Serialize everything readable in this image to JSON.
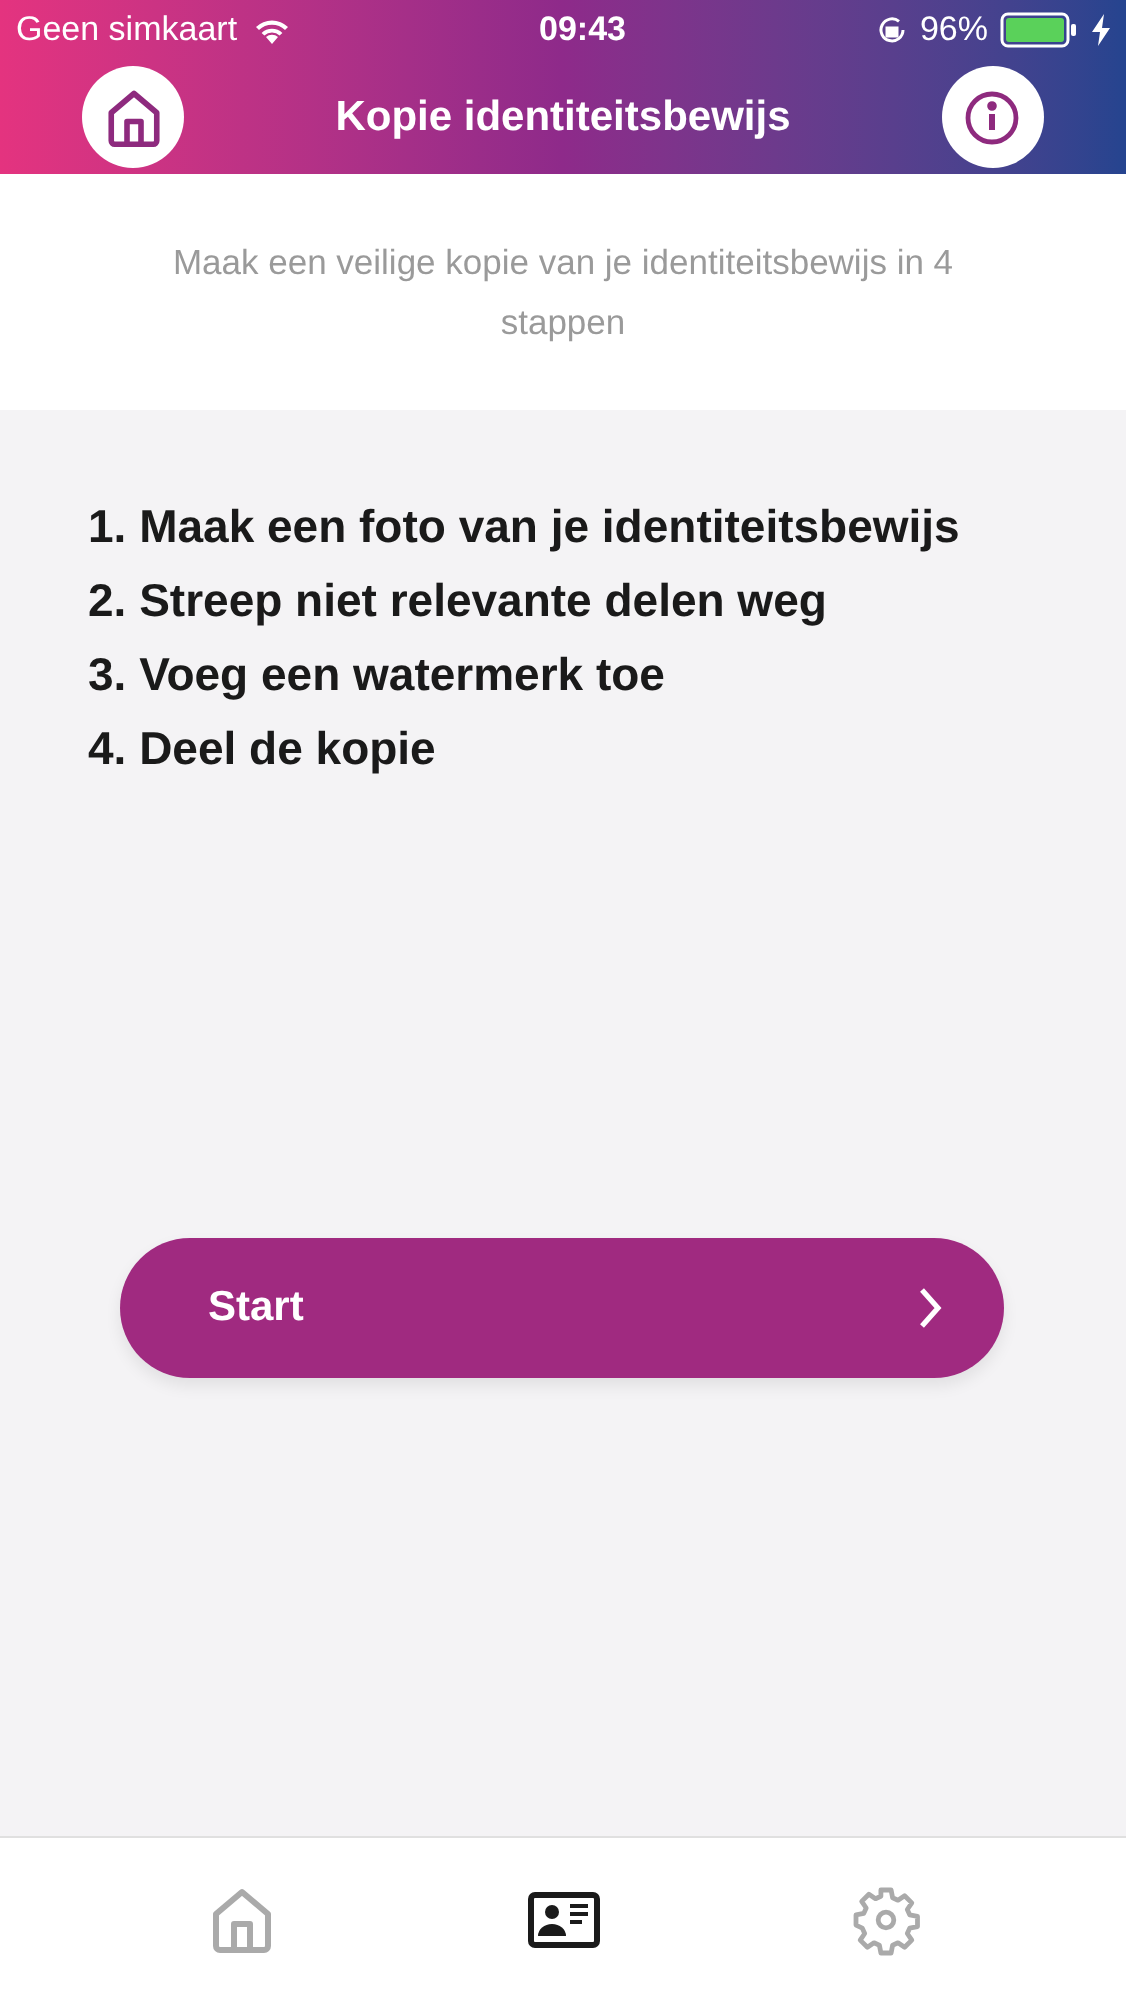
{
  "status_bar": {
    "carrier": "Geen simkaart",
    "time": "09:43",
    "battery": "96%"
  },
  "header": {
    "title": "Kopie identiteitsbewijs"
  },
  "intro": "Maak een veilige kopie van je identiteitsbewijs in 4 stappen",
  "steps": [
    "1. Maak een foto van je identiteitsbewijs",
    "2. Streep niet relevante delen weg",
    "3. Voeg een watermerk toe",
    "4. Deel de kopie"
  ],
  "start_button": {
    "label": "Start"
  },
  "tab_bar": [
    {
      "kind": "home",
      "selected": false
    },
    {
      "kind": "id-card",
      "selected": true
    },
    {
      "kind": "settings",
      "selected": false
    }
  ]
}
